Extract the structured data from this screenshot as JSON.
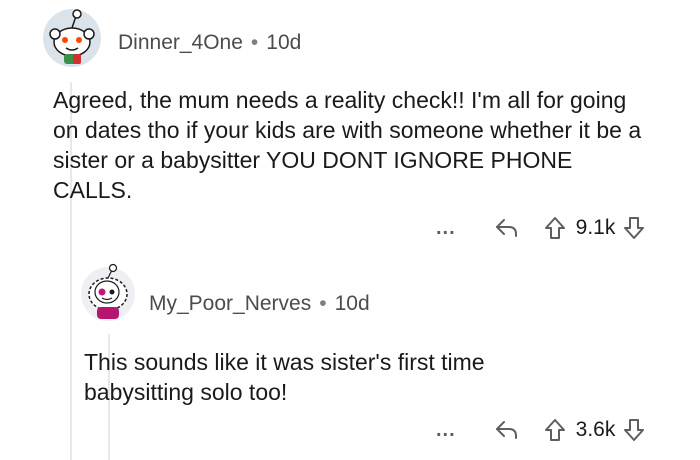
{
  "comments": [
    {
      "username": "Dinner_4One",
      "age": "10d",
      "separator": "•",
      "body": "Agreed, the mum needs a reality check!! I'm all for going on dates tho if your kids are with someone whether it be a sister or a babysitter YOU DONT IGNORE PHONE CALLS.",
      "more": "...",
      "votes": "9.1k"
    },
    {
      "username": "My_Poor_Nerves",
      "age": "10d",
      "separator": "•",
      "body": "This sounds like it was sister's first time babysitting solo too!",
      "more": "...",
      "votes": "3.6k"
    }
  ],
  "icons": [
    "snoo-avatar-icon",
    "reply-arrow-icon",
    "upvote-icon",
    "downvote-icon",
    "more-options-icon"
  ],
  "colors": {
    "thread_line": "#e6e8ea",
    "text": "#1a1a1b",
    "meta": "#4a4d50"
  }
}
